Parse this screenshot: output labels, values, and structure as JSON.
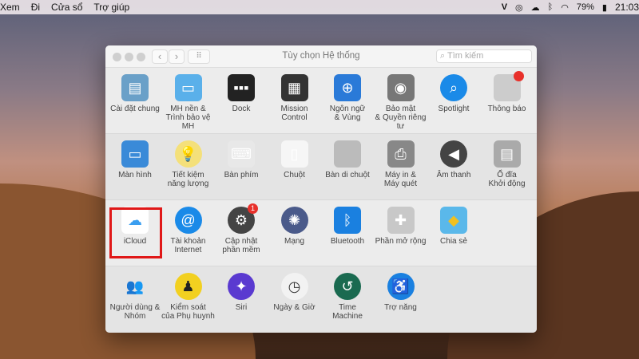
{
  "menubar": {
    "items": [
      "Xem",
      "Đi",
      "Cửa sổ",
      "Trợ giúp"
    ],
    "status": {
      "v": "V",
      "battery": "79%",
      "time": "21:03"
    }
  },
  "window": {
    "title": "Tùy chọn Hệ thống",
    "search_placeholder": "Tìm kiếm",
    "back": "‹",
    "forward": "›",
    "grid": "⠿"
  },
  "sections": [
    {
      "items": [
        {
          "name": "general",
          "label": "Cài đặt chung",
          "icon": "general-icon",
          "color": "#6aa0c8",
          "glyph": "▤"
        },
        {
          "name": "desktop",
          "label": "MH nền &\nTrình bảo vệ MH",
          "icon": "desktop-screensaver-icon",
          "color": "#5ab0ea",
          "glyph": "▭"
        },
        {
          "name": "dock",
          "label": "Dock",
          "icon": "dock-icon",
          "color": "#222",
          "glyph": "▪▪▪"
        },
        {
          "name": "mission-control",
          "label": "Mission\nControl",
          "icon": "mission-control-icon",
          "color": "#333",
          "glyph": "▦"
        },
        {
          "name": "language",
          "label": "Ngôn ngữ\n& Vùng",
          "icon": "globe-flag-icon",
          "color": "#2a7ad8",
          "glyph": "⊕"
        },
        {
          "name": "security",
          "label": "Bảo mật\n& Quyền riêng tư",
          "icon": "house-security-icon",
          "color": "#777",
          "glyph": "◉"
        },
        {
          "name": "spotlight",
          "label": "Spotlight",
          "icon": "spotlight-icon",
          "color": "#1a8ae8",
          "glyph": "⌕",
          "round": true
        },
        {
          "name": "notifications",
          "label": "Thông báo",
          "icon": "notifications-icon",
          "color": "#ccc",
          "glyph": "",
          "dot": true
        }
      ]
    },
    {
      "items": [
        {
          "name": "displays",
          "label": "Màn hình",
          "icon": "display-icon",
          "color": "#3a8ad8",
          "glyph": "▭"
        },
        {
          "name": "energy",
          "label": "Tiết kiệm\nnăng lượng",
          "icon": "lightbulb-icon",
          "color": "#f4e07a",
          "glyph": "💡",
          "round": true
        },
        {
          "name": "keyboard",
          "label": "Bàn phím",
          "icon": "keyboard-icon",
          "color": "#e8e8e8",
          "glyph": "⌨"
        },
        {
          "name": "mouse",
          "label": "Chuột",
          "icon": "mouse-icon",
          "color": "#f6f6f6",
          "glyph": "▯"
        },
        {
          "name": "trackpad",
          "label": "Bàn di chuột",
          "icon": "trackpad-icon",
          "color": "#bbb",
          "glyph": ""
        },
        {
          "name": "printers",
          "label": "Máy in &\nMáy quét",
          "icon": "printer-icon",
          "color": "#888",
          "glyph": "⎙"
        },
        {
          "name": "sound",
          "label": "Âm thanh",
          "icon": "speaker-icon",
          "color": "#444",
          "glyph": "◀",
          "round": true
        },
        {
          "name": "startup-disk",
          "label": "Ổ đĩa\nKhởi động",
          "icon": "hard-drive-icon",
          "color": "#aaa",
          "glyph": "▤"
        }
      ]
    },
    {
      "items": [
        {
          "name": "icloud",
          "label": "iCloud",
          "icon": "icloud-icon",
          "color": "#fff",
          "glyph": "☁",
          "glyphColor": "#3a9ef0"
        },
        {
          "name": "internet-accounts",
          "label": "Tài khoản\nInternet",
          "icon": "at-sign-icon",
          "color": "#1a8ae8",
          "glyph": "@",
          "round": true
        },
        {
          "name": "software-update",
          "label": "Cập nhật\nphần mềm",
          "icon": "gear-update-icon",
          "color": "#444",
          "glyph": "⚙",
          "round": true,
          "badge": "1"
        },
        {
          "name": "network",
          "label": "Mạng",
          "icon": "network-globe-icon",
          "color": "#4a5a8a",
          "glyph": "✺",
          "round": true
        },
        {
          "name": "bluetooth",
          "label": "Bluetooth",
          "icon": "bluetooth-icon",
          "color": "#1a80e0",
          "glyph": "ᛒ"
        },
        {
          "name": "extensions",
          "label": "Phần mở rộng",
          "icon": "puzzle-icon",
          "color": "#c8c8c8",
          "glyph": "✚"
        },
        {
          "name": "sharing",
          "label": "Chia sẻ",
          "icon": "sharing-folder-icon",
          "color": "#5ab8ea",
          "glyph": "◆",
          "glyphColor": "#f0c020"
        }
      ]
    },
    {
      "items": [
        {
          "name": "users-groups",
          "label": "Người dùng &\nNhóm",
          "icon": "users-icon",
          "color": "transparent",
          "glyph": "👥",
          "glyphColor": "#555"
        },
        {
          "name": "parental-controls",
          "label": "Kiểm soát\ncủa Phụ huynh",
          "icon": "parental-controls-icon",
          "color": "#f2d020",
          "glyph": "♟",
          "glyphColor": "#222",
          "round": true
        },
        {
          "name": "siri",
          "label": "Siri",
          "icon": "siri-icon",
          "color": "#5a3ad0",
          "glyph": "✦",
          "round": true
        },
        {
          "name": "date-time",
          "label": "Ngày & Giờ",
          "icon": "clock-icon",
          "color": "#f2f2f2",
          "glyph": "◷",
          "glyphColor": "#333",
          "round": true
        },
        {
          "name": "time-machine",
          "label": "Time\nMachine",
          "icon": "time-machine-icon",
          "color": "#1a6a50",
          "glyph": "↺",
          "round": true
        },
        {
          "name": "accessibility",
          "label": "Trợ năng",
          "icon": "accessibility-icon",
          "color": "#1a80e0",
          "glyph": "♿",
          "round": true
        }
      ]
    }
  ]
}
